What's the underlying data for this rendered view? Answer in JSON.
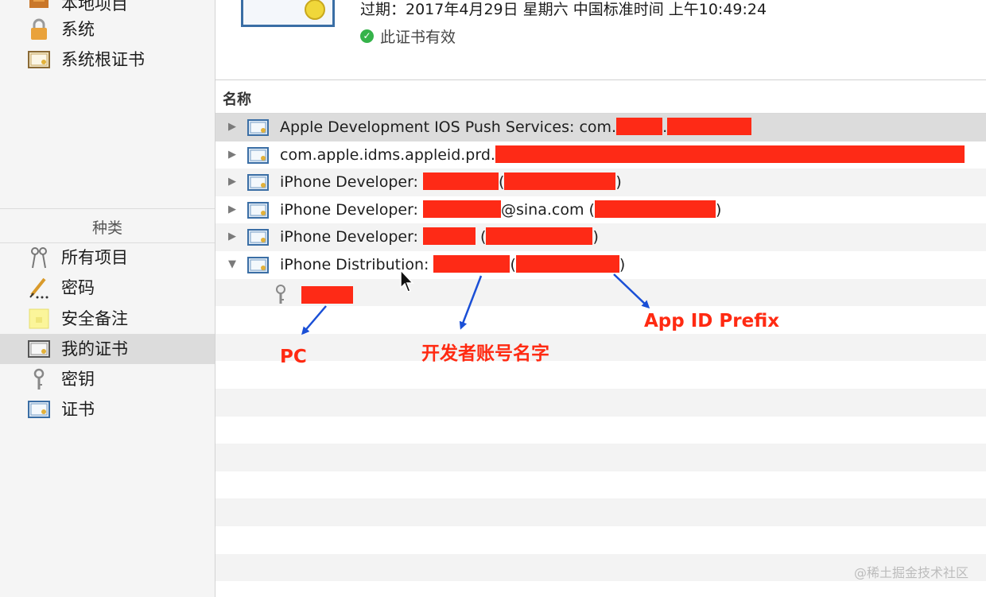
{
  "sidebar": {
    "items_top": [
      {
        "label": "本地项目",
        "icon": "folder-icon"
      },
      {
        "label": "系统",
        "icon": "lock-icon"
      },
      {
        "label": "系统根证书",
        "icon": "certificate-icon"
      }
    ],
    "section_title": "种类",
    "items_category": [
      {
        "label": "所有项目",
        "icon": "keys-icon"
      },
      {
        "label": "密码",
        "icon": "pencil-icon"
      },
      {
        "label": "安全备注",
        "icon": "note-icon"
      },
      {
        "label": "我的证书",
        "icon": "certificate-icon"
      },
      {
        "label": "密钥",
        "icon": "key-icon"
      },
      {
        "label": "证书",
        "icon": "certificate-icon"
      }
    ],
    "selected": "我的证书"
  },
  "detail": {
    "expiry": "过期：2017年4月29日 星期六 中国标准时间 上午10:49:24",
    "valid_icon": "checkmark-icon",
    "valid_text": "此证书有效",
    "valid_color": "#35b34a"
  },
  "list": {
    "column_name": "名称",
    "rows": [
      {
        "prefix": "Apple Development IOS Push Services: com.",
        "mid": ".",
        "suffix": ""
      },
      {
        "prefix": "com.apple.idms.appleid.prd.",
        "mid": "",
        "suffix": ""
      },
      {
        "prefix": "iPhone Developer: ",
        "mid": "(",
        "suffix": ")"
      },
      {
        "prefix": "iPhone Developer: ",
        "mid": "@sina.com (",
        "suffix": ")"
      },
      {
        "prefix": "iPhone Developer: ",
        "mid": " (",
        "suffix": ")"
      },
      {
        "prefix": "iPhone Distribution: ",
        "mid": "(",
        "suffix": ")"
      }
    ]
  },
  "annotations": {
    "pc": "PC",
    "account_name": "开发者账号名字",
    "app_id_prefix": "App ID Prefix",
    "color": "#ff2a12"
  },
  "watermark": "@稀土掘金技术社区",
  "colors": {
    "redaction": "#fe2a16",
    "arrow": "#1a4fd6"
  }
}
